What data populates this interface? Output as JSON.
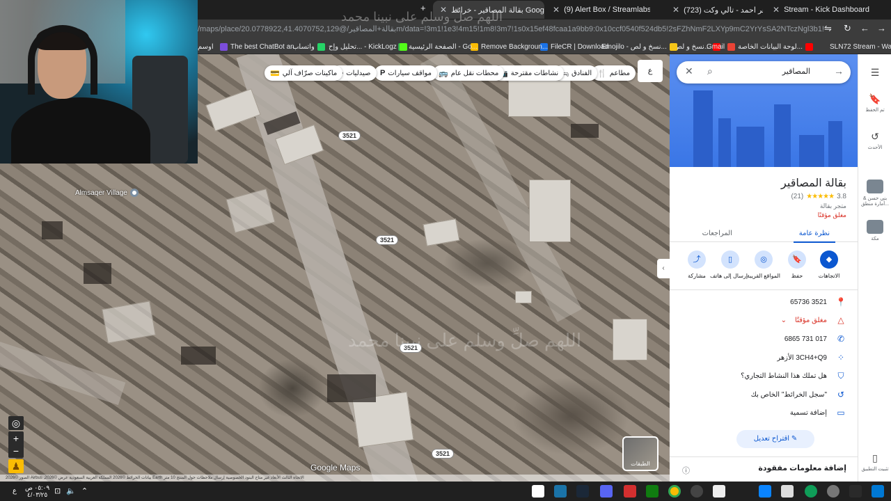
{
  "browser": {
    "tabs": [
      {
        "label": "بقالة المصاقير - خرائط Google",
        "active": true,
        "favicon_color": "#34a853"
      },
      {
        "label": "(9) Alert Box / Streamlabs",
        "active": false,
        "favicon_color": "#31c3a2"
      },
      {
        "label": "(723) ماهر احمد - تالي وكت",
        "active": false,
        "favicon_color": "#ff0000"
      },
      {
        "label": "Stream - Kick Dashboard",
        "active": false,
        "favicon_color": "#53fc18"
      }
    ],
    "url": "/maps/place/بقالة+المصاقير/@20.0778922,41.4070752,129m/data=!3m1!1e3!4m15!1m8!3m7!1s0x15ef48fcaa1a9bb9:0x10ccf0540f524db5!2sFZhNmF2LXYp9mC2YrYsSA2NTczNgl3b1!8m2!3d20.07922...",
    "bookmarks": [
      {
        "label": "SLN72 Stream - Wat...",
        "color": "#ff0000"
      },
      {
        "label": "لوحة البيانات الخاصة...",
        "color": "#ff0000"
      },
      {
        "label": "نسخ و لص...",
        "color": "#ff0000"
      },
      {
        "label": "Gmail",
        "color": "#ea4335"
      },
      {
        "label": "Emojilo - نسخ و لص...",
        "color": "#f5c518"
      },
      {
        "label": "FileCR | Download",
        "color": "#1a73e8"
      },
      {
        "label": "Remove Backgroun...",
        "color": "#fbbc04"
      },
      {
        "label": "الصفحة الرئيسية - Go...",
        "color": "#34a853"
      },
      {
        "label": "تحليل وإح... - KickLogz",
        "color": "#53fc18"
      },
      {
        "label": "واتساب",
        "color": "#25d366"
      },
      {
        "label": "The best ChatBot an...",
        "color": "#7b4ddb"
      },
      {
        "label": "اوسم",
        "color": "#9aa0a6"
      }
    ]
  },
  "map": {
    "chips": [
      {
        "label": "مطاعم",
        "icon": "fork-knife-icon",
        "glyph": "🍴"
      },
      {
        "label": "الفنادق",
        "icon": "bed-icon",
        "glyph": "🛏"
      },
      {
        "label": "نشاطات مقترحة",
        "icon": "camera-icon",
        "glyph": "📷"
      },
      {
        "label": "محطات نقل عام",
        "icon": "bus-icon",
        "glyph": "🚌"
      },
      {
        "label": "مواقف سيارات",
        "icon": "parking-icon",
        "glyph": "P"
      },
      {
        "label": "صيدليات",
        "icon": "pharmacy-icon",
        "glyph": "✚"
      },
      {
        "label": "ماكينات صرّاف آلي",
        "icon": "atm-icon",
        "glyph": "💳"
      }
    ],
    "village_label": "Almsaqer Village",
    "road_labels": [
      "3521",
      "3521",
      "3521",
      "3521"
    ],
    "google_maps_label": "Google Maps",
    "layers_label": "الطبقات",
    "attribution": "الصور ©2026 Airbus ,2026© بيانات الخرائط ©2026 المملكة العربية السعودية  عرض Earth  الاتجاه الثالث الأبعاد غير متاح  البنود  الخصوصية  إرسال ملاحظات حول المنتج  10 متر",
    "zoom_in": "+",
    "zoom_out": "−",
    "modes_label": "ع",
    "watermark": "اللهم صلِّ وسلم على نبينا محمد"
  },
  "panel": {
    "search_value": "المصاقير",
    "place_name": "بقالة المصاقير",
    "rating": "3.8",
    "stars": "★★★★★",
    "reviews_count": "(21)",
    "place_type": "متجر بقالة",
    "closed_status": "مغلق مؤقتًا",
    "tabs": {
      "overview": "نظرة عامة",
      "reviews": "المراجعات"
    },
    "actions": [
      {
        "label": "الاتجاهات",
        "glyph": "◆",
        "name": "directions-icon"
      },
      {
        "label": "حفظ",
        "glyph": "🔖",
        "name": "bookmark-icon"
      },
      {
        "label": "المواقع القريبة",
        "glyph": "◎",
        "name": "nearby-icon"
      },
      {
        "label": "إرسال إلى هاتف",
        "glyph": "▯",
        "name": "phone-send-icon"
      },
      {
        "label": "مشاركة",
        "glyph": "⤴",
        "name": "share-icon"
      }
    ],
    "info": {
      "address": "3521 65736",
      "status": "مغلق مؤقتًا",
      "phone": "017 731 6865",
      "plus_code": "3CH4+Q9 الأزهر",
      "own_business": "هل تملك هذا النشاط التجاري؟",
      "history": "\"سجل الخرائط\" الخاص بك",
      "add_label": "إضافة تسمية"
    },
    "suggest_edit": "اقتراح تعديل",
    "add_missing": "إضافة معلومات مفقودة"
  },
  "rail": {
    "saved": "تم الحفظ",
    "recent": "الأحدث",
    "recent_item_1": "بني حسن & أمارة منطق...",
    "recent_item_2": "مكة",
    "install": "تثبيت التطبيق"
  },
  "taskbar": {
    "time": "٠٥:٠٩ ص",
    "date": "٤/٠٣/٢٥",
    "lang": "ع"
  }
}
